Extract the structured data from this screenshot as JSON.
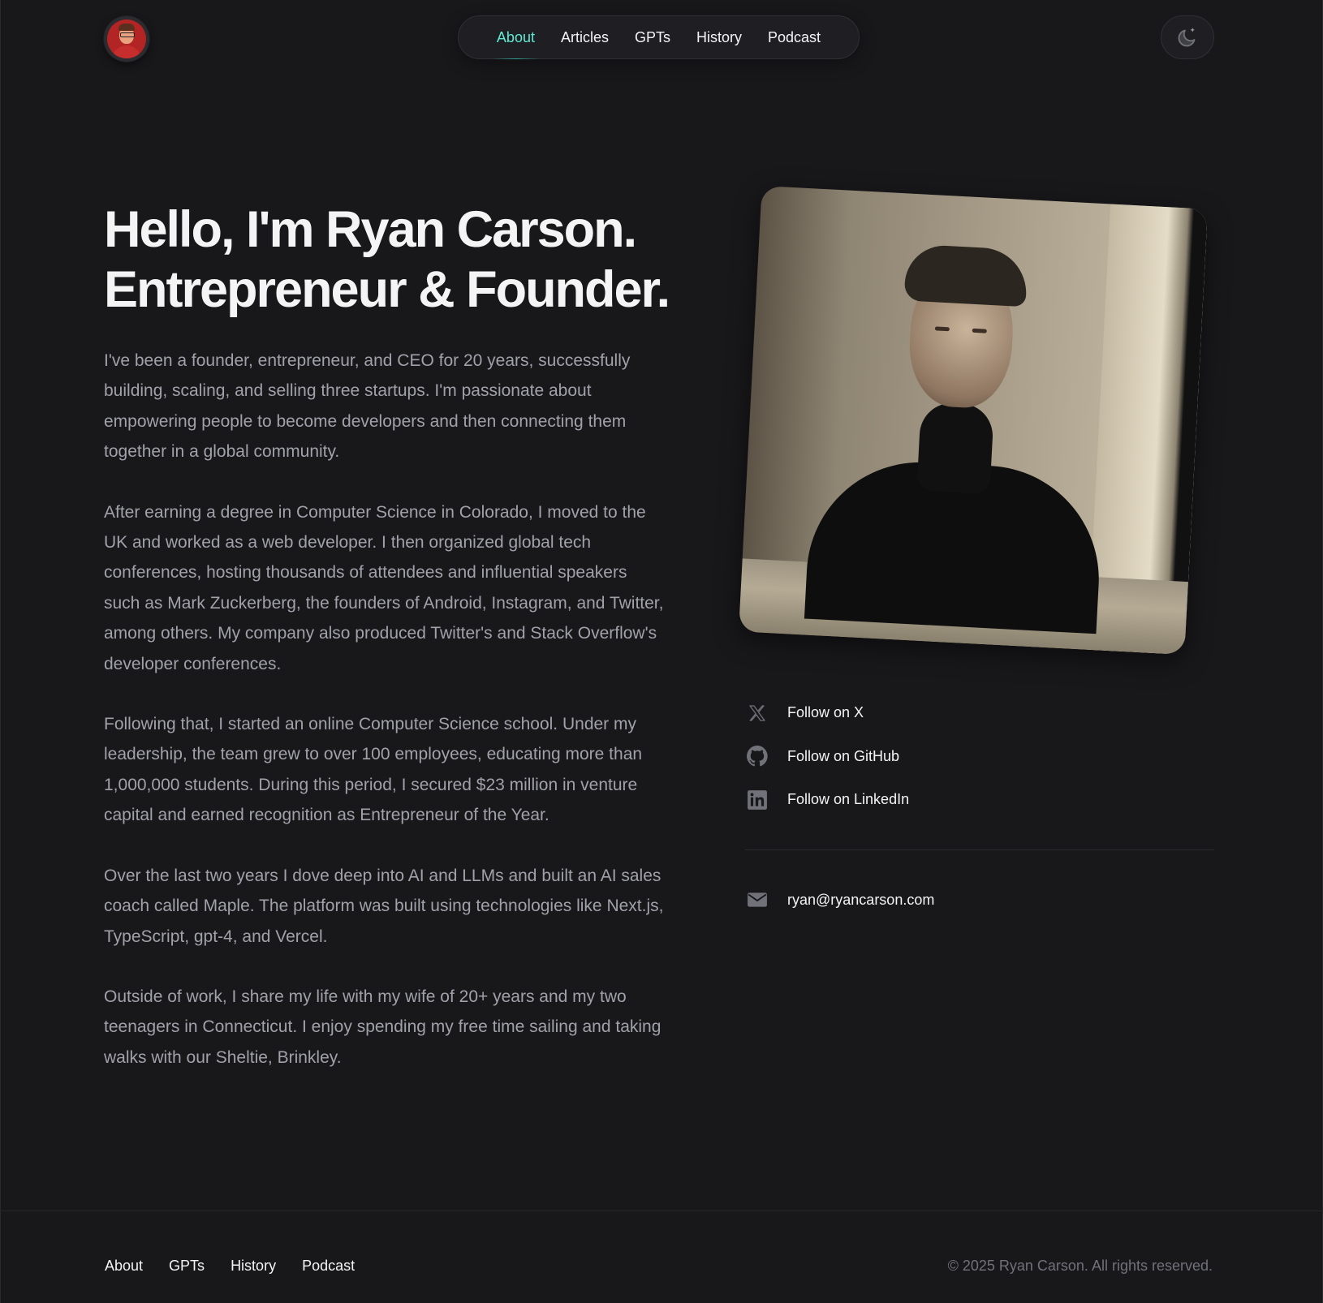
{
  "header": {
    "nav": [
      {
        "label": "About",
        "active": true
      },
      {
        "label": "Articles",
        "active": false
      },
      {
        "label": "GPTs",
        "active": false
      },
      {
        "label": "History",
        "active": false
      },
      {
        "label": "Podcast",
        "active": false
      }
    ],
    "theme_icon": "moon-sparkle-icon",
    "accent_color": "#5eead4"
  },
  "hero": {
    "title_line1": "Hello, I'm Ryan Carson.",
    "title_line2": "Entrepreneur & Founder.",
    "paragraphs": [
      "I've been a founder, entrepreneur, and CEO for 20 years, successfully building, scaling, and selling three startups. I'm passionate about empowering people to become developers and then connecting them together in a global community.",
      "After earning a degree in Computer Science in Colorado, I moved to the UK and worked as a web developer. I then organized global tech conferences, hosting thousands of attendees and influential speakers such as Mark Zuckerberg, the founders of Android, Instagram, and Twitter, among others. My company also produced Twitter's and Stack Overflow's developer conferences.",
      "Following that, I started an online Computer Science school. Under my leadership, the team grew to over 100 employees, educating more than 1,000,000 students. During this period, I secured $23 million in venture capital and earned recognition as Entrepreneur of the Year.",
      "Over the last two years I dove deep into AI and LLMs and built an AI sales coach called Maple. The platform was built using technologies like Next.js, TypeScript, gpt-4, and Vercel.",
      "Outside of work, I share my life with my wife of 20+ years and my two teenagers in Connecticut. I enjoy spending my free time sailing and taking walks with our Sheltie, Brinkley."
    ]
  },
  "social": {
    "x_label": "Follow on X",
    "github_label": "Follow on GitHub",
    "linkedin_label": "Follow on LinkedIn",
    "email": "ryan@ryancarson.com"
  },
  "footer": {
    "nav": [
      "About",
      "GPTs",
      "History",
      "Podcast"
    ],
    "copyright": "© 2025 Ryan Carson. All rights reserved."
  }
}
